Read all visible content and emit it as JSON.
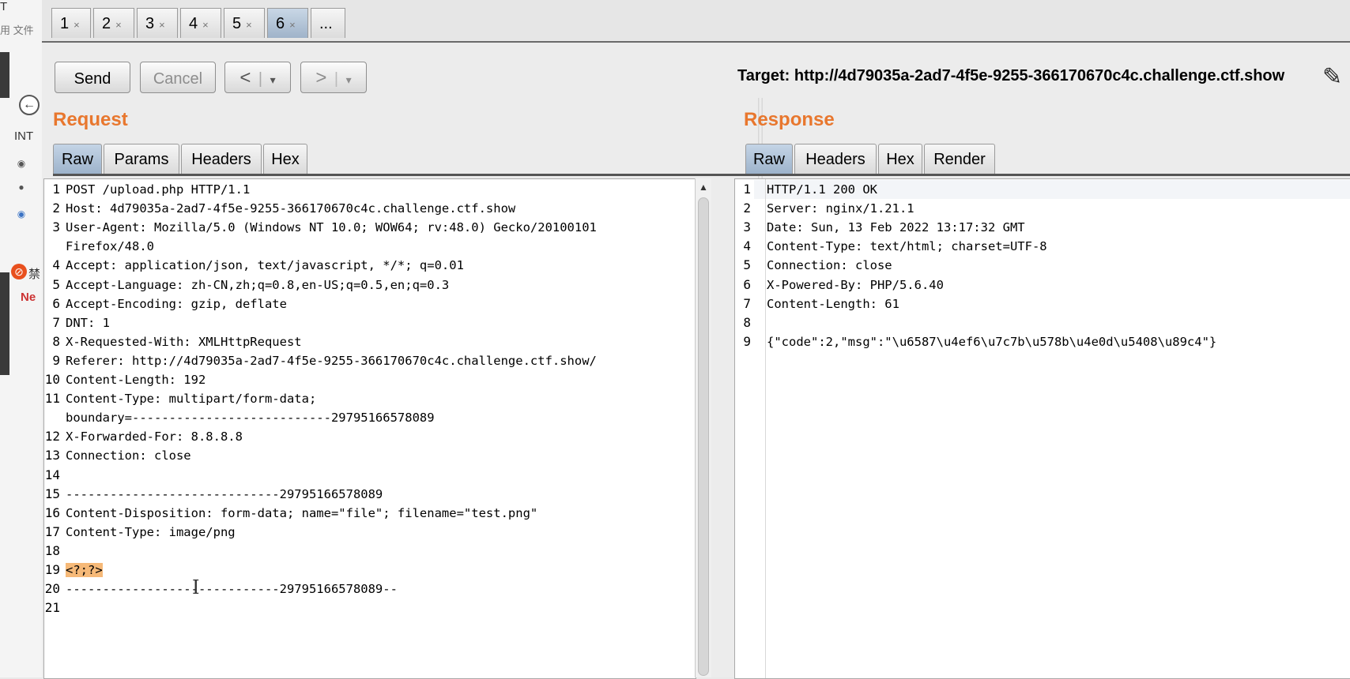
{
  "background_app": {
    "labels": [
      "T",
      "用 文件",
      "INT",
      "禁",
      "Ne"
    ]
  },
  "tabs": [
    "1",
    "2",
    "3",
    "4",
    "5",
    "6",
    "..."
  ],
  "tab_close_glyph": "×",
  "active_tab": "6",
  "toolbar": {
    "send": "Send",
    "cancel": "Cancel",
    "back": "<",
    "forward": ">",
    "dropdown_glyph": "▾",
    "target_label": "Target:",
    "target_url": "http://4d79035a-2ad7-4f5e-9255-366170670c4c.challenge.ctf.show"
  },
  "request": {
    "title": "Request",
    "tabs": [
      "Raw",
      "Params",
      "Headers",
      "Hex"
    ],
    "active_tab": "Raw",
    "lines": [
      {
        "n": "1",
        "text": "POST /upload.php HTTP/1.1"
      },
      {
        "n": "2",
        "text": "Host: 4d79035a-2ad7-4f5e-9255-366170670c4c.challenge.ctf.show"
      },
      {
        "n": "3",
        "text": "User-Agent: Mozilla/5.0 (Windows NT 10.0; WOW64; rv:48.0) Gecko/20100101"
      },
      {
        "n": "",
        "text": "Firefox/48.0"
      },
      {
        "n": "4",
        "text": "Accept: application/json, text/javascript, */*; q=0.01"
      },
      {
        "n": "5",
        "text": "Accept-Language: zh-CN,zh;q=0.8,en-US;q=0.5,en;q=0.3"
      },
      {
        "n": "6",
        "text": "Accept-Encoding: gzip, deflate"
      },
      {
        "n": "7",
        "text": "DNT: 1"
      },
      {
        "n": "8",
        "text": "X-Requested-With: XMLHttpRequest"
      },
      {
        "n": "9",
        "text": "Referer: http://4d79035a-2ad7-4f5e-9255-366170670c4c.challenge.ctf.show/"
      },
      {
        "n": "10",
        "text": "Content-Length: 192"
      },
      {
        "n": "11",
        "text": "Content-Type: multipart/form-data;"
      },
      {
        "n": "",
        "text": "boundary=---------------------------29795166578089"
      },
      {
        "n": "12",
        "text": "X-Forwarded-For: 8.8.8.8"
      },
      {
        "n": "13",
        "text": "Connection: close"
      },
      {
        "n": "14",
        "text": ""
      },
      {
        "n": "15",
        "text": "-----------------------------29795166578089"
      },
      {
        "n": "16",
        "text": "Content-Disposition: form-data; name=\"file\"; filename=\"test.png\""
      },
      {
        "n": "17",
        "text": "Content-Type: image/png"
      },
      {
        "n": "18",
        "text": ""
      },
      {
        "n": "19",
        "text": "<?;?>",
        "highlight": true
      },
      {
        "n": "20",
        "text": "-----------------------------29795166578089--"
      },
      {
        "n": "21",
        "text": ""
      }
    ]
  },
  "response": {
    "title": "Response",
    "tabs": [
      "Raw",
      "Headers",
      "Hex",
      "Render"
    ],
    "active_tab": "Raw",
    "lines": [
      {
        "n": "1",
        "text": "HTTP/1.1 200 OK"
      },
      {
        "n": "2",
        "text": "Server: nginx/1.21.1"
      },
      {
        "n": "3",
        "text": "Date: Sun, 13 Feb 2022 13:17:32 GMT"
      },
      {
        "n": "4",
        "text": "Content-Type: text/html; charset=UTF-8"
      },
      {
        "n": "5",
        "text": "Connection: close"
      },
      {
        "n": "6",
        "text": "X-Powered-By: PHP/5.6.40"
      },
      {
        "n": "7",
        "text": "Content-Length: 61"
      },
      {
        "n": "8",
        "text": ""
      },
      {
        "n": "9",
        "text": "{\"code\":2,\"msg\":\"\\u6587\\u4ef6\\u7c7b\\u578b\\u4e0d\\u5408\\u89c4\"}"
      }
    ]
  },
  "icons": {
    "pencil": "pencil-icon",
    "back_arrow": "arrow-left-icon",
    "text_cursor": "ibeam-cursor-icon"
  }
}
